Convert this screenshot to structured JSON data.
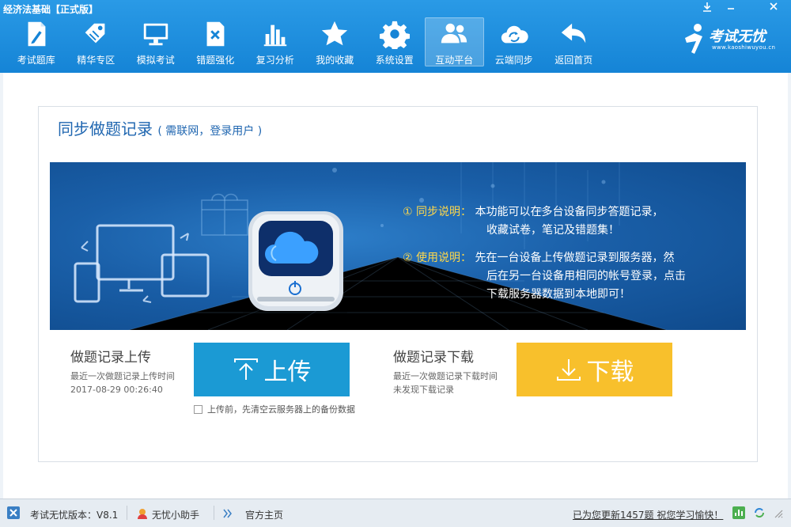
{
  "app": {
    "title": "经济法基础【正式版】"
  },
  "nav": [
    {
      "label": "考试题库"
    },
    {
      "label": "精华专区"
    },
    {
      "label": "模拟考试"
    },
    {
      "label": "错题强化"
    },
    {
      "label": "复习分析"
    },
    {
      "label": "我的收藏"
    },
    {
      "label": "系统设置"
    },
    {
      "label": "互动平台"
    },
    {
      "label": "云端同步"
    },
    {
      "label": "返回首页"
    }
  ],
  "logo": {
    "name": "考试无忧",
    "url": "www.kaoshiwuyou.cn"
  },
  "sync": {
    "title": "同步做题记录",
    "subtitle": "( 需联网，登录用户 )",
    "info1_tag": "① 同步说明：",
    "info1_line1": "本功能可以在多台设备同步答题记录，",
    "info1_line2": "收藏试卷，笔记及错题集！",
    "info2_tag": "② 使用说明：",
    "info2_line1": "先在一台设备上传做题记录到服务器，然",
    "info2_line2": "后在另一台设备用相同的帐号登录，点击",
    "info2_line3": "下载服务器数据到本地即可！",
    "upload_title": "做题记录上传",
    "upload_last": "最近一次做题记录上传时间",
    "upload_time": "2017-08-29 00:26:40",
    "upload_button": "上传",
    "clear_checkbox": "上传前，先清空云服务器上的备份数据",
    "download_title": "做题记录下载",
    "download_last": "最近一次做题记录下载时间",
    "download_status": "未发现下载记录",
    "download_button": "下载"
  },
  "status": {
    "version": "考试无忧版本：V8.1",
    "assistant": "无忧小助手",
    "homepage": "官方主页",
    "update_msg": "已为您更新1457题 祝您学习愉快！"
  },
  "colors": {
    "header": "#1b8ee0",
    "upload": "#1b9ad4",
    "download": "#f8c02c",
    "title": "#1f66b0"
  }
}
